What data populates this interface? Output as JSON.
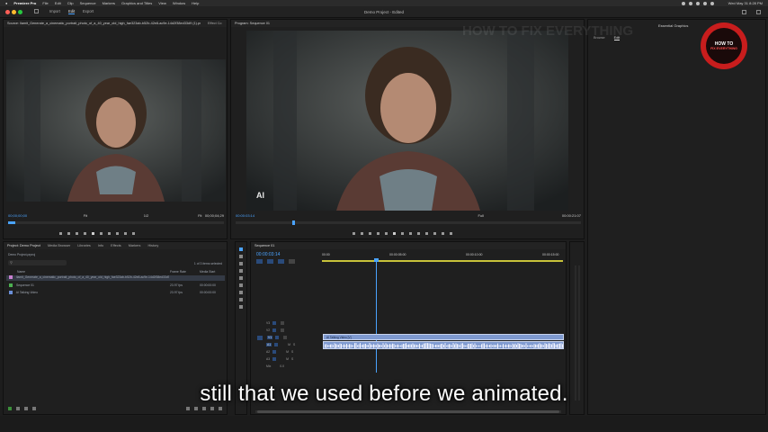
{
  "menubar": {
    "apple": "",
    "items": [
      "Premiere Pro",
      "File",
      "Edit",
      "Clip",
      "Sequence",
      "Markers",
      "Graphics and Titles",
      "View",
      "Window",
      "Help"
    ],
    "clock": "Wed May 31 8:28 PM"
  },
  "titlebar": {
    "tabs": [
      "Import",
      "Edit",
      "Export"
    ],
    "active_tab": "Edit",
    "project_title": "Demo Project - Edited"
  },
  "source_monitor": {
    "header": "Source: llamit_Generate_a_cinematic_portrait_photo_of_a_40_year_old_high_fae323ab-b52b-42e8-ac9e-14d2f38ed33d9 (1).png",
    "header2": "Effect Co",
    "timecode_in": "00;00;00;00",
    "fit": "Fit",
    "ratio": "1/2",
    "timecode_out": "00;00;04;29"
  },
  "program_monitor": {
    "header": "Program: Sequence 01",
    "timecode_in": "00:00:03:14",
    "fit": "Fit",
    "quality": "Full",
    "timecode_out": "00:00:21:07",
    "badge": "AI"
  },
  "right_panel": {
    "tabs": [
      "Browse",
      "Edit"
    ],
    "title": "Essential Graphics",
    "watermark": "HOW TO FIX EVERYTHING"
  },
  "logo": {
    "line1": "HOW TO",
    "line2": "FIX EVERYTHING"
  },
  "project_panel": {
    "tabs": [
      "Project: Demo Project",
      "Media Browser",
      "Libraries",
      "Info",
      "Effects",
      "Markers",
      "History"
    ],
    "file": "Demo Project.prproj",
    "selection": "1 of 3 items selected",
    "columns": [
      "Name",
      "Frame Rate",
      "Media Start"
    ],
    "rows": [
      {
        "name": "llamit_Generate_a_cinematic_portrait_photo_of_a_40_year_old_high_fae323ab-b52b-42e8-ac9e-14d2f38ed33d9 (1).png",
        "rate": "",
        "start": "",
        "color": "#c880d0"
      },
      {
        "name": "Sequence 01",
        "rate": "23.97 fps",
        "start": "00:00:00:00",
        "color": "#4caf50"
      },
      {
        "name": "AI Talking Video",
        "rate": "23.97 fps",
        "start": "00:00:00:00",
        "color": "#6a8fd8"
      }
    ]
  },
  "timeline": {
    "tab": "Sequence 01",
    "timecode": "00:00:03:14",
    "ruler": [
      "00:00",
      "00:00:05:00",
      "00:00:10:00",
      "00:00:15:00"
    ],
    "video_tracks": [
      "V3",
      "V2",
      "V1"
    ],
    "audio_tracks": [
      "A1",
      "A2",
      "A3"
    ],
    "mix": "Mix",
    "mix_value": "0.0",
    "clip_label": "AI Talking Video [V]"
  },
  "caption": "still that we used before we animated."
}
